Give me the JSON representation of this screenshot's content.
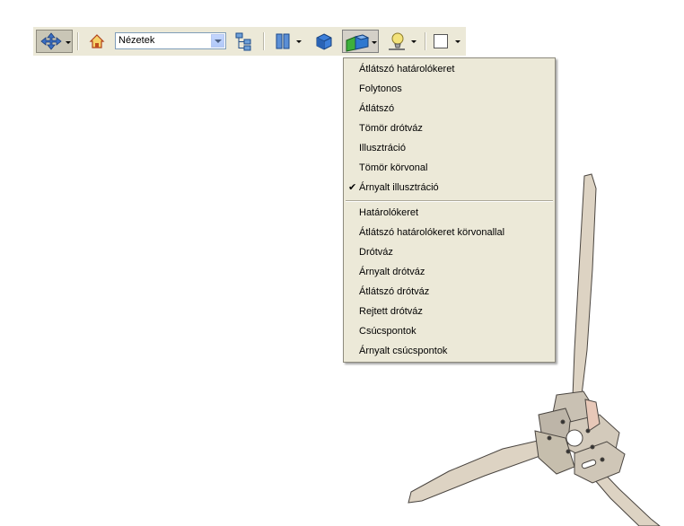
{
  "toolbar": {
    "views_select_value": "Nézetek"
  },
  "render_menu": {
    "group1": [
      {
        "label": "Átlátszó határolókeret",
        "checked": false
      },
      {
        "label": "Folytonos",
        "checked": false
      },
      {
        "label": "Átlátszó",
        "checked": false
      },
      {
        "label": "Tömör drótváz",
        "checked": false
      },
      {
        "label": "Illusztráció",
        "checked": false
      },
      {
        "label": "Tömör körvonal",
        "checked": false
      },
      {
        "label": "Árnyalt illusztráció",
        "checked": true
      }
    ],
    "group2": [
      {
        "label": "Határolókeret"
      },
      {
        "label": "Átlátszó határolókeret körvonallal"
      },
      {
        "label": "Drótváz"
      },
      {
        "label": "Árnyalt drótváz"
      },
      {
        "label": "Átlátszó drótváz"
      },
      {
        "label": "Rejtett drótváz"
      },
      {
        "label": "Csúcspontok"
      },
      {
        "label": "Árnyalt csúcspontok"
      }
    ],
    "check_glyph": "✔"
  },
  "colors": {
    "toolbar_bg": "#ece9d8",
    "model_fill": "#ddd3c3",
    "model_stroke": "#4a4540"
  },
  "icons": [
    "navigate-icon",
    "home-icon",
    "model-tree-icon",
    "cross-section-icon",
    "box-icon",
    "render-mode-icon",
    "lighting-icon",
    "background-color-icon"
  ]
}
